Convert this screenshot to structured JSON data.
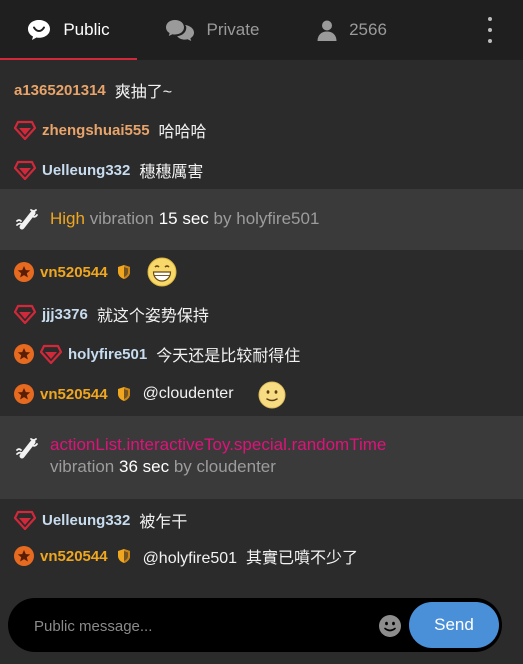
{
  "tabs": {
    "public": "Public",
    "private": "Private",
    "users_count": "2566"
  },
  "messages": [
    {
      "user": "a1365201314",
      "text": "爽抽了~"
    },
    {
      "user": "zhengshuai555",
      "text": "哈哈哈"
    },
    {
      "user": "Uelleung332",
      "text": "穗穗厲害"
    },
    {
      "user": "vn520544",
      "text": ""
    },
    {
      "user": "jjj3376",
      "text": "就这个姿势保持"
    },
    {
      "user": "holyfire501",
      "text": "今天还是比较耐得住"
    },
    {
      "user": "vn520544",
      "text": "@cloudenter"
    },
    {
      "user": "Uelleung332",
      "text": "被乍干"
    },
    {
      "user": "vn520544",
      "text": "@holyfire501  其實已噴不少了"
    }
  ],
  "notices": [
    {
      "level": "High",
      "word": "vibration",
      "duration": "15 sec",
      "by": "by",
      "user": "holyfire501"
    },
    {
      "action": "actionList.interactiveToy.special.randomTime",
      "word": "vibration",
      "duration": "36 sec",
      "by": "by",
      "user": "cloudenter"
    }
  ],
  "composer": {
    "placeholder": "Public message...",
    "send_label": "Send"
  },
  "colors": {
    "accent_red": "#d1283a",
    "send_blue": "#4a90d9",
    "username_gold": "#f0a71f",
    "username_orange": "#e8a46a",
    "username_light": "#c8dcf0",
    "action_pink": "#e0127a"
  },
  "icons": {
    "public_tab": "speech-bubble-icon",
    "private_tab": "two-bubbles-icon",
    "users_tab": "user-icon",
    "menu": "kebab-menu-icon",
    "tip": "vibration-icon",
    "gem": "gem-badge-icon",
    "star": "star-badge-icon",
    "shield": "shield-badge-icon",
    "emoji": "smiley-icon"
  }
}
